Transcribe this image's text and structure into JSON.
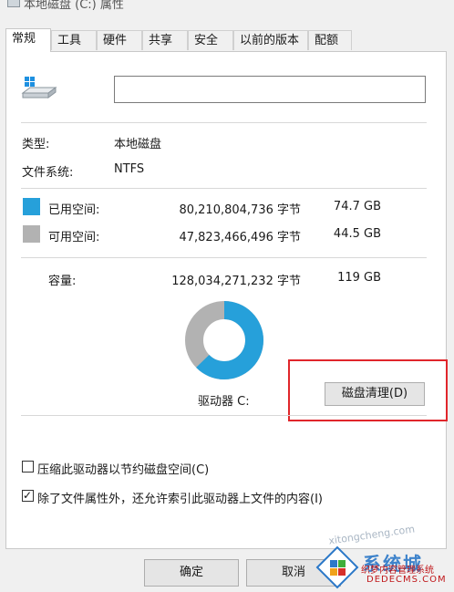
{
  "window": {
    "title": "本地磁盘 (C:) 属性"
  },
  "tabs": [
    {
      "label": "常规",
      "active": true
    },
    {
      "label": "工具"
    },
    {
      "label": "硬件"
    },
    {
      "label": "共享"
    },
    {
      "label": "安全"
    },
    {
      "label": "以前的版本"
    },
    {
      "label": "配额"
    }
  ],
  "general": {
    "name_value": "",
    "type_label": "类型:",
    "type_value": "本地磁盘",
    "fs_label": "文件系统:",
    "fs_value": "NTFS",
    "used_label": "已用空间:",
    "used_bytes": "80,210,804,736 字节",
    "used_size": "74.7 GB",
    "free_label": "可用空间:",
    "free_bytes": "47,823,466,496 字节",
    "free_size": "44.5 GB",
    "capacity_label": "容量:",
    "capacity_bytes": "128,034,271,232 字节",
    "capacity_size": "119 GB",
    "drive_label": "驱动器 C:",
    "cleanup_button": "磁盘清理(D)",
    "compress_label": "压缩此驱动器以节约磁盘空间(C)",
    "compress_checked": false,
    "index_label": "除了文件属性外，还允许索引此驱动器上文件的内容(I)",
    "index_checked": true
  },
  "usage_chart": {
    "used_fraction": 0.6265,
    "used_color": "#26a0da",
    "free_color": "#b2b2b2"
  },
  "buttons": {
    "ok": "确定",
    "cancel": "取消"
  },
  "watermark": {
    "brand": "系统城",
    "line1": "织梦内容管理系统",
    "line2": "DEDECMS.COM",
    "site": "xitongcheng.com"
  }
}
